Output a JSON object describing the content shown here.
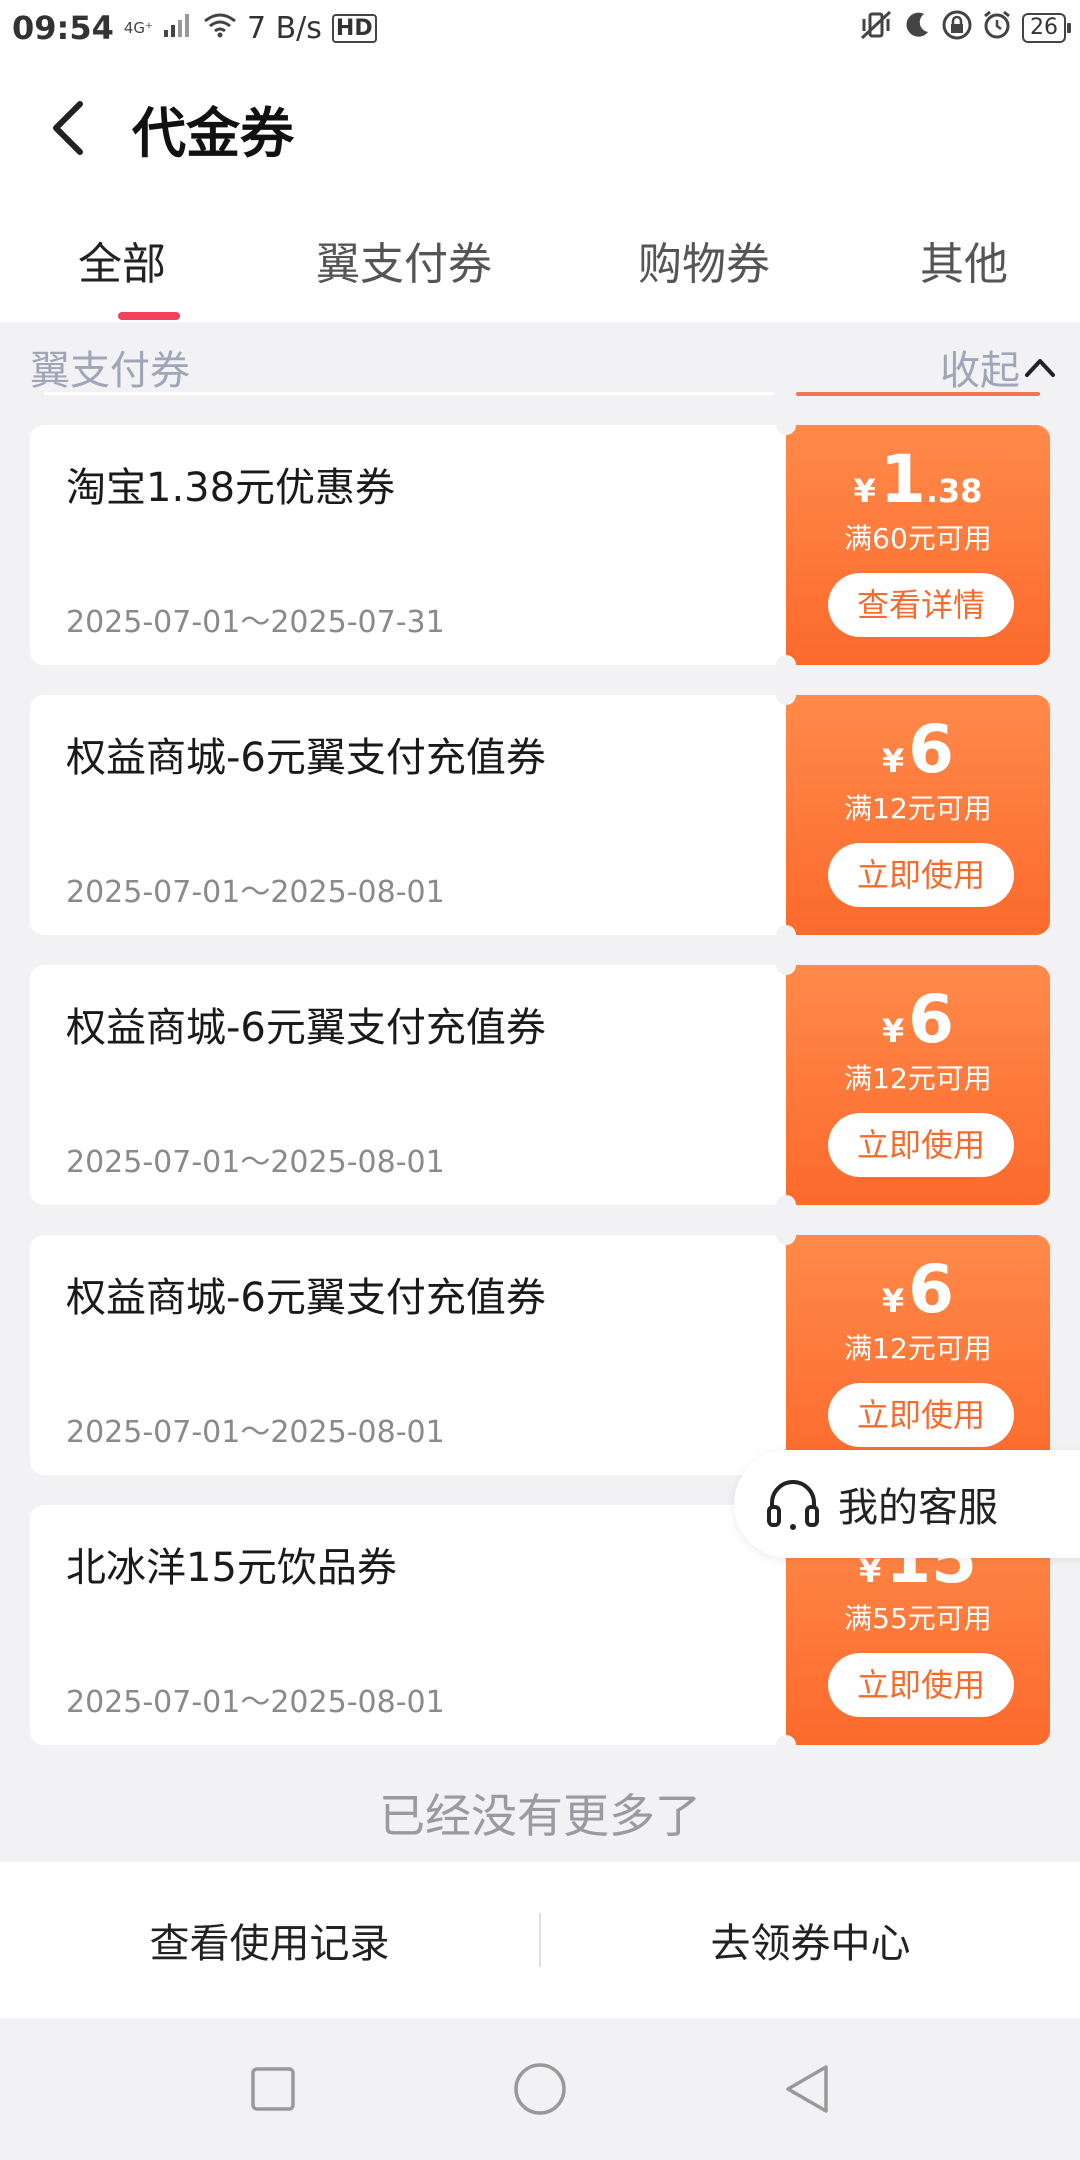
{
  "status_bar": {
    "time": "09:54",
    "network": "4G⁺",
    "speed": "7 B/s",
    "hd": "HD",
    "battery": "26"
  },
  "header": {
    "title": "代金券"
  },
  "tabs": [
    {
      "label": "全部",
      "active": true
    },
    {
      "label": "翼支付券",
      "active": false
    },
    {
      "label": "购物券",
      "active": false
    },
    {
      "label": "其他",
      "active": false
    }
  ],
  "section": {
    "title": "翼支付券",
    "collapse_label": "收起"
  },
  "coupons": [
    {
      "name": "淘宝1.38元优惠券",
      "date": "2025-07-01～2025-07-31",
      "currency": "¥",
      "price_int": "1",
      "price_dec": ".38",
      "condition": "满60元可用",
      "button": "查看详情"
    },
    {
      "name": "权益商城-6元翼支付充值券",
      "date": "2025-07-01～2025-08-01",
      "currency": "¥",
      "price_int": "6",
      "price_dec": "",
      "condition": "满12元可用",
      "button": "立即使用"
    },
    {
      "name": "权益商城-6元翼支付充值券",
      "date": "2025-07-01～2025-08-01",
      "currency": "¥",
      "price_int": "6",
      "price_dec": "",
      "condition": "满12元可用",
      "button": "立即使用"
    },
    {
      "name": "权益商城-6元翼支付充值券",
      "date": "2025-07-01～2025-08-01",
      "currency": "¥",
      "price_int": "6",
      "price_dec": "",
      "condition": "满12元可用",
      "button": "立即使用"
    },
    {
      "name": "北冰洋15元饮品券",
      "date": "2025-07-01～2025-08-01",
      "currency": "¥",
      "price_int": "15",
      "price_dec": "",
      "condition": "满55元可用",
      "button": "立即使用"
    }
  ],
  "float_service": {
    "label": "我的客服",
    "icon": "headset-icon"
  },
  "no_more": "已经没有更多了",
  "bottom_bar": {
    "left": "查看使用记录",
    "right": "去领券中心"
  },
  "colors": {
    "accent_red": "#f2425b",
    "coupon_orange": "#fc6a2c",
    "muted": "#a0a6b8"
  }
}
